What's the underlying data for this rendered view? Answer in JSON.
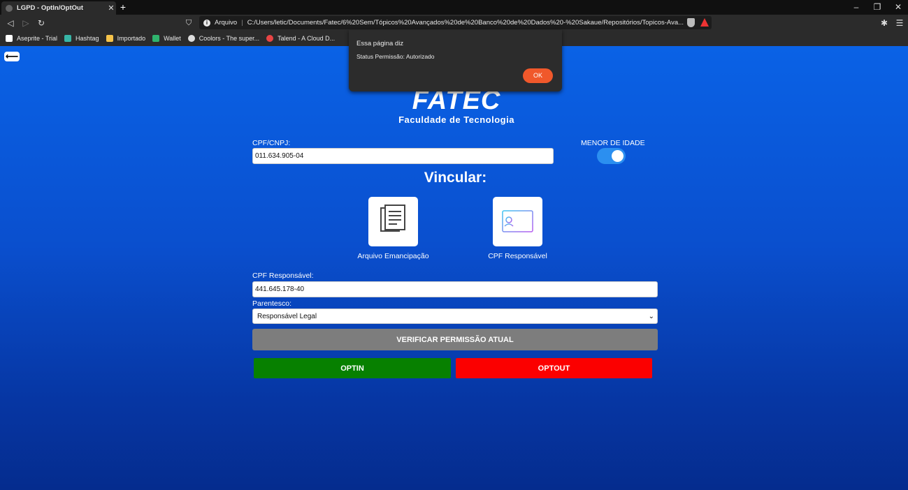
{
  "browser": {
    "tab_title": "LGPD - OptIn/OptOut",
    "tab_close": "✕",
    "new_tab": "+",
    "window_controls": [
      "–",
      "❐",
      "✕"
    ],
    "address_scheme": "Arquivo",
    "address_url": "C:/Users/letic/Documents/Fatec/6%20Sem/Tópicos%20Avançados%20de%20Banco%20de%20Dados%20-%20Sakaue/Repositórios/Topicos-Ava...",
    "bookmarks": [
      {
        "label": "Aseprite - Trial",
        "color": "#ffffff"
      },
      {
        "label": "Hashtag",
        "color": "#37b5a6"
      },
      {
        "label": "Importado",
        "color": "#f6c34a"
      },
      {
        "label": "Wallet",
        "color": "#2fb36d"
      },
      {
        "label": "Coolors - The super...",
        "color": "#dddddd"
      },
      {
        "label": "Talend - A Cloud D...",
        "color": "#e84444"
      }
    ]
  },
  "dialog": {
    "title": "Essa página diz",
    "message": "Status Permissão: Autorizado",
    "ok_label": "OK"
  },
  "page": {
    "back_label": "⟵",
    "logo_main": "FATEC",
    "logo_sub": "Faculdade de Tecnologia",
    "cpf_label": "CPF/CNPJ:",
    "cpf_value": "011.634.905-04",
    "minor_label": "MENOR DE IDADE",
    "minor_on": true,
    "vincular_title": "Vincular:",
    "card_emancipacao": "Arquivo Emancipação",
    "card_responsavel": "CPF Responsável",
    "cpf_resp_label": "CPF Responsável:",
    "cpf_resp_value": "441.645.178-40",
    "parentesco_label": "Parentesco:",
    "parentesco_value": "Responsável Legal",
    "verify_label": "VERIFICAR PERMISSÃO ATUAL",
    "optin_label": "OPTIN",
    "optout_label": "OPTOUT"
  },
  "colors": {
    "accent": "#0a62e6",
    "optin": "#078000",
    "optout": "#fb0000",
    "verify": "#7d7d7d",
    "ok_button": "#f0582b"
  }
}
